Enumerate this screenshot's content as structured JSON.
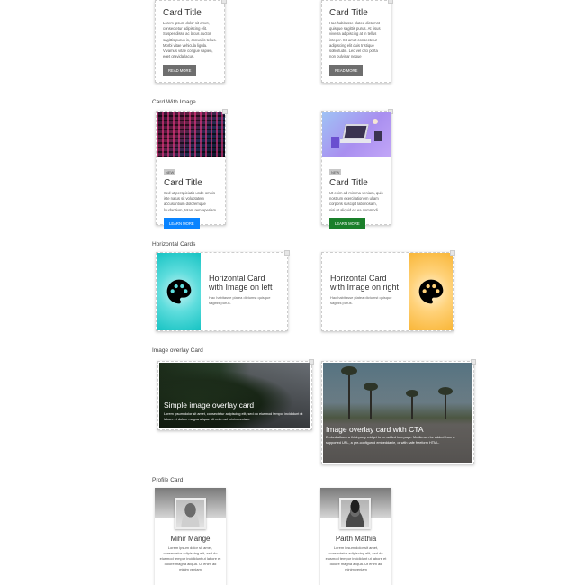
{
  "sections": {
    "card_with_image": "Card With Image",
    "horizontal_cards": "Horizontal Cards",
    "image_overlay_card": "Image overlay Card",
    "profile_card": "Profile Card"
  },
  "basic_cards": [
    {
      "title": "Card Title",
      "text": "Lorem ipsum dolor sit amet, consectetur adipiscing elit. Suspendisse ac lacus auctor, sagittis purus in, convallis tellus. Morbi vitae vehicula ligula. Vivamus vitae congue sapien, eget gravida lacus.",
      "button": "READ MORE"
    },
    {
      "title": "Card Title",
      "text": "Hac habitasse platea dictumst quisque sagittis purus. At risus viverra adipiscing at in tellus integer. Sit amet consectetur adipiscing elit duis tristique sollicitudin. Leo vel orci porta non pulvinar neque",
      "button": "READ MORE"
    }
  ],
  "image_cards": [
    {
      "badge": "NEW",
      "title": "Card Title",
      "text": "Sed ut perspiciatis unde omnis iste natus sit voluptatem accusantium doloremque laudantium, totam rem aperiam.",
      "button": "LEARN MORE",
      "button_color": "#0a84ff"
    },
    {
      "badge": "NEW",
      "title": "Card Title",
      "text": "Ut enim ad minima veniam, quis nostrum exercitationem ullam corporis suscipit laboriosam, nisi ut aliquid ex ea commodi.",
      "button": "LEARN MORE",
      "button_color": "#1a7f2a"
    }
  ],
  "horizontal_cards": [
    {
      "title": "Horizontal Card with Image on left",
      "text": "Hac habitasse platea dictumst quisque sagittis purus.",
      "icon": "palette-icon",
      "image_color": "#19c7c7"
    },
    {
      "title": "Horizontal Card with Image on right",
      "text": "Hac habitasse platea dictumst quisque sagittis purus.",
      "icon": "palette-icon",
      "image_color": "#fbbf3a"
    }
  ],
  "overlay_cards": [
    {
      "title": "Simple image overlay card",
      "text": "Lorem ipsum dolor sit amet, consectetur adipiscing elit, sed do eiusmod tempor incididunt ut labore et dolore magna aliqua. Ut enim ad minim veniam."
    },
    {
      "title": "Image overlay card with CTA",
      "text": "Embed allows a third-party widget to be added to a page. Media can be added from a supported URL, a pre-configured embeddable, or with safe freeform HTML."
    }
  ],
  "profile_cards": [
    {
      "name": "Mihir Mange",
      "text": "Lorem ipsum dolor sit amet, consectetur adipiscing elit, sed do eiusmod tempor incididunt ut labore et dolore magna aliqua. Ut enim ad minim veniam"
    },
    {
      "name": "Parth Mathia",
      "text": "Lorem ipsum dolor sit amet, consectetur adipiscing elit, sed do eiusmod tempor incididunt ut labore et dolore magna aliqua. Ut enim ad minim veniam"
    }
  ]
}
